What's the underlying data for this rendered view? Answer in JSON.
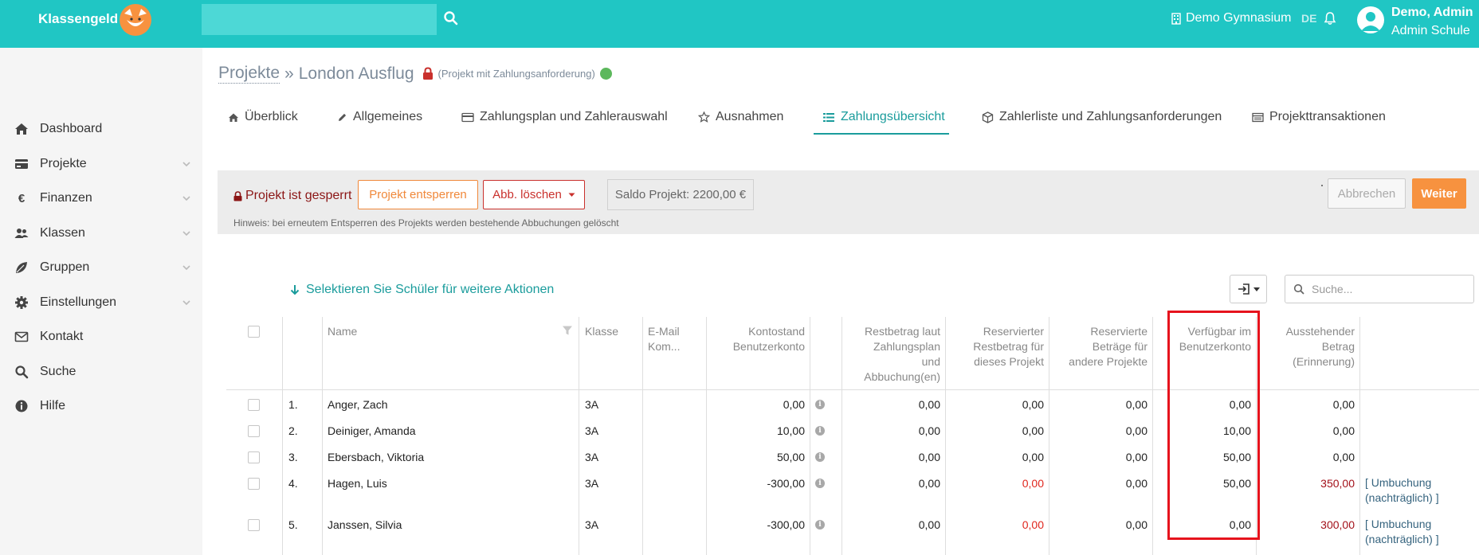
{
  "header": {
    "brand": "Klassengeld",
    "search_value": "",
    "school": "Demo Gymnasium",
    "lang": "DE",
    "user_name": "Demo, Admin",
    "user_role": "Admin Schule"
  },
  "sidebar": {
    "items": [
      {
        "label": "Dashboard",
        "icon": "home-icon"
      },
      {
        "label": "Projekte",
        "icon": "card-icon"
      },
      {
        "label": "Finanzen",
        "icon": "euro-icon"
      },
      {
        "label": "Klassen",
        "icon": "users-icon"
      },
      {
        "label": "Gruppen",
        "icon": "leaf-icon"
      },
      {
        "label": "Einstellungen",
        "icon": "gear-icon"
      },
      {
        "label": "Kontakt",
        "icon": "envelope-icon"
      },
      {
        "label": "Suche",
        "icon": "search-icon"
      },
      {
        "label": "Hilfe",
        "icon": "info-icon"
      }
    ]
  },
  "breadcrumb": {
    "root": "Projekte",
    "separator": "»",
    "current": "London Ausflug",
    "subtitle": "(Projekt mit Zahlungsanforderung)"
  },
  "tabs": [
    {
      "label": "Überblick"
    },
    {
      "label": "Allgemeines"
    },
    {
      "label": "Zahlungsplan und Zahlerauswahl"
    },
    {
      "label": "Ausnahmen"
    },
    {
      "label": "Zahlungsübersicht"
    },
    {
      "label": "Zahlerliste und Zahlungsanforderungen"
    },
    {
      "label": "Projekttransaktionen"
    }
  ],
  "panel": {
    "locked_text": "Projekt ist gesperrt",
    "unlock_label": "Projekt entsperren",
    "delete_label": "Abb. löschen",
    "saldo": "Saldo Projekt: 2200,00 €",
    "cancel_label": "Abbrechen",
    "next_label": "Weiter",
    "hint": "Hinweis: bei erneutem Entsperren des Projekts werden bestehende Abbuchungen gelöscht"
  },
  "table_tools": {
    "select_link": "Selektieren Sie Schüler für weitere Aktionen",
    "search_placeholder": "Suche..."
  },
  "table": {
    "headers": {
      "name": "Name",
      "klasse": "Klasse",
      "email_1": "E-Mail",
      "email_2": "Kom...",
      "konto_1": "Kontostand",
      "konto_2": "Benutzerkonto",
      "rest_1": "Restbetrag laut",
      "rest_2": "Zahlungsplan",
      "rest_3": "und",
      "rest_4": "Abbuchung(en)",
      "resv_1": "Reservierter",
      "resv_2": "Restbetrag für",
      "resv_3": "dieses Projekt",
      "reso_1": "Reservierte",
      "reso_2": "Beträge für",
      "reso_3": "andere Projekte",
      "verf_1": "Verfügbar im",
      "verf_2": "Benutzerkonto",
      "aus_1": "Ausstehender",
      "aus_2": "Betrag",
      "aus_3": "(Erinnerung)"
    },
    "rows": [
      {
        "nr": "1.",
        "name": "Anger, Zach",
        "klasse": "3A",
        "konto": "0,00",
        "rest": "0,00",
        "resv": "0,00",
        "reso": "0,00",
        "verf": "0,00",
        "aus": "0,00",
        "action_1": "",
        "action_2": ""
      },
      {
        "nr": "2.",
        "name": "Deiniger, Amanda",
        "klasse": "3A",
        "konto": "10,00",
        "rest": "0,00",
        "resv": "0,00",
        "reso": "0,00",
        "verf": "10,00",
        "aus": "0,00",
        "action_1": "",
        "action_2": ""
      },
      {
        "nr": "3.",
        "name": "Ebersbach, Viktoria",
        "klasse": "3A",
        "konto": "50,00",
        "rest": "0,00",
        "resv": "0,00",
        "reso": "0,00",
        "verf": "50,00",
        "aus": "0,00",
        "action_1": "",
        "action_2": ""
      },
      {
        "nr": "4.",
        "name": "Hagen, Luis",
        "klasse": "3A",
        "konto": "-300,00",
        "rest": "0,00",
        "resv": "0,00",
        "reso": "0,00",
        "verf": "50,00",
        "aus": "350,00",
        "action_1": "[ Umbuchung",
        "action_2": "(nachträglich) ]"
      },
      {
        "nr": "5.",
        "name": "Janssen, Silvia",
        "klasse": "3A",
        "konto": "-300,00",
        "rest": "0,00",
        "resv": "0,00",
        "reso": "0,00",
        "verf": "0,00",
        "aus": "300,00",
        "action_1": "[ Umbuchung",
        "action_2": "(nachträglich) ]"
      }
    ]
  },
  "colors": {
    "accent": "#20c6c4",
    "tab_active": "#1a9c9c",
    "orange": "#f7923f",
    "danger": "#c9302c",
    "highlight": "#e6131d"
  }
}
